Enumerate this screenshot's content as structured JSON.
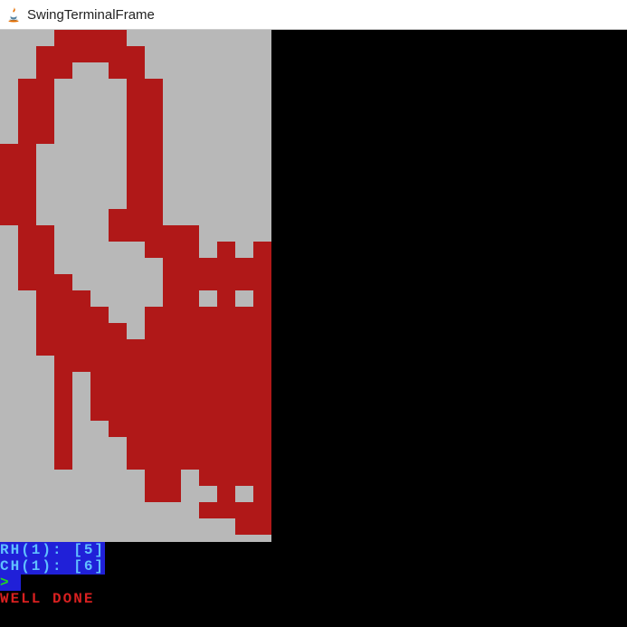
{
  "window": {
    "title": "SwingTerminalFrame"
  },
  "art": {
    "cols": 15,
    "rows": 31,
    "palette": {
      "red": "#b01818",
      "grey": "#b8b8b8",
      "orange": "#e08020",
      "black": "#000000"
    },
    "pixels": [
      "...RRRR........",
      "..RRRRRR.......",
      "..RR..RR.......",
      ".RR....RR......",
      ".RR....RR......",
      ".RR....RR......",
      ".RR....RR......",
      "RR.....RR......",
      "RR.....RR......",
      "RR.....RR......",
      "RR.....RR......",
      "RR....RRR......",
      ".RR...RRRRR....",
      ".RR.....RRR.R.R",
      ".RR......RRRRRR",
      ".RRR.....RRRRRR",
      "..RRR....RR.R.R",
      "..RRRR..RRRRRRR",
      "..RRRRR.RRRRRRR",
      "..RRRRRRRRRRRRR",
      "...RRRRRRRRRRRR",
      "...R.RRRRRRRRRR",
      "...R.RRRRRRRRRR",
      "...R.RRRRRRRRRR",
      "...R..RRRRRRRRR",
      "...R...RRRRRRRR",
      "...R...RRRRRRRR",
      "........RR.RRRR",
      "........RR..R.R",
      "...........RRRR",
      ".............RR"
    ]
  },
  "console": {
    "line1": "RH(1): [5]",
    "line2": "CH(1): [6]",
    "prompt": "> ",
    "message": "WELL DONE"
  }
}
